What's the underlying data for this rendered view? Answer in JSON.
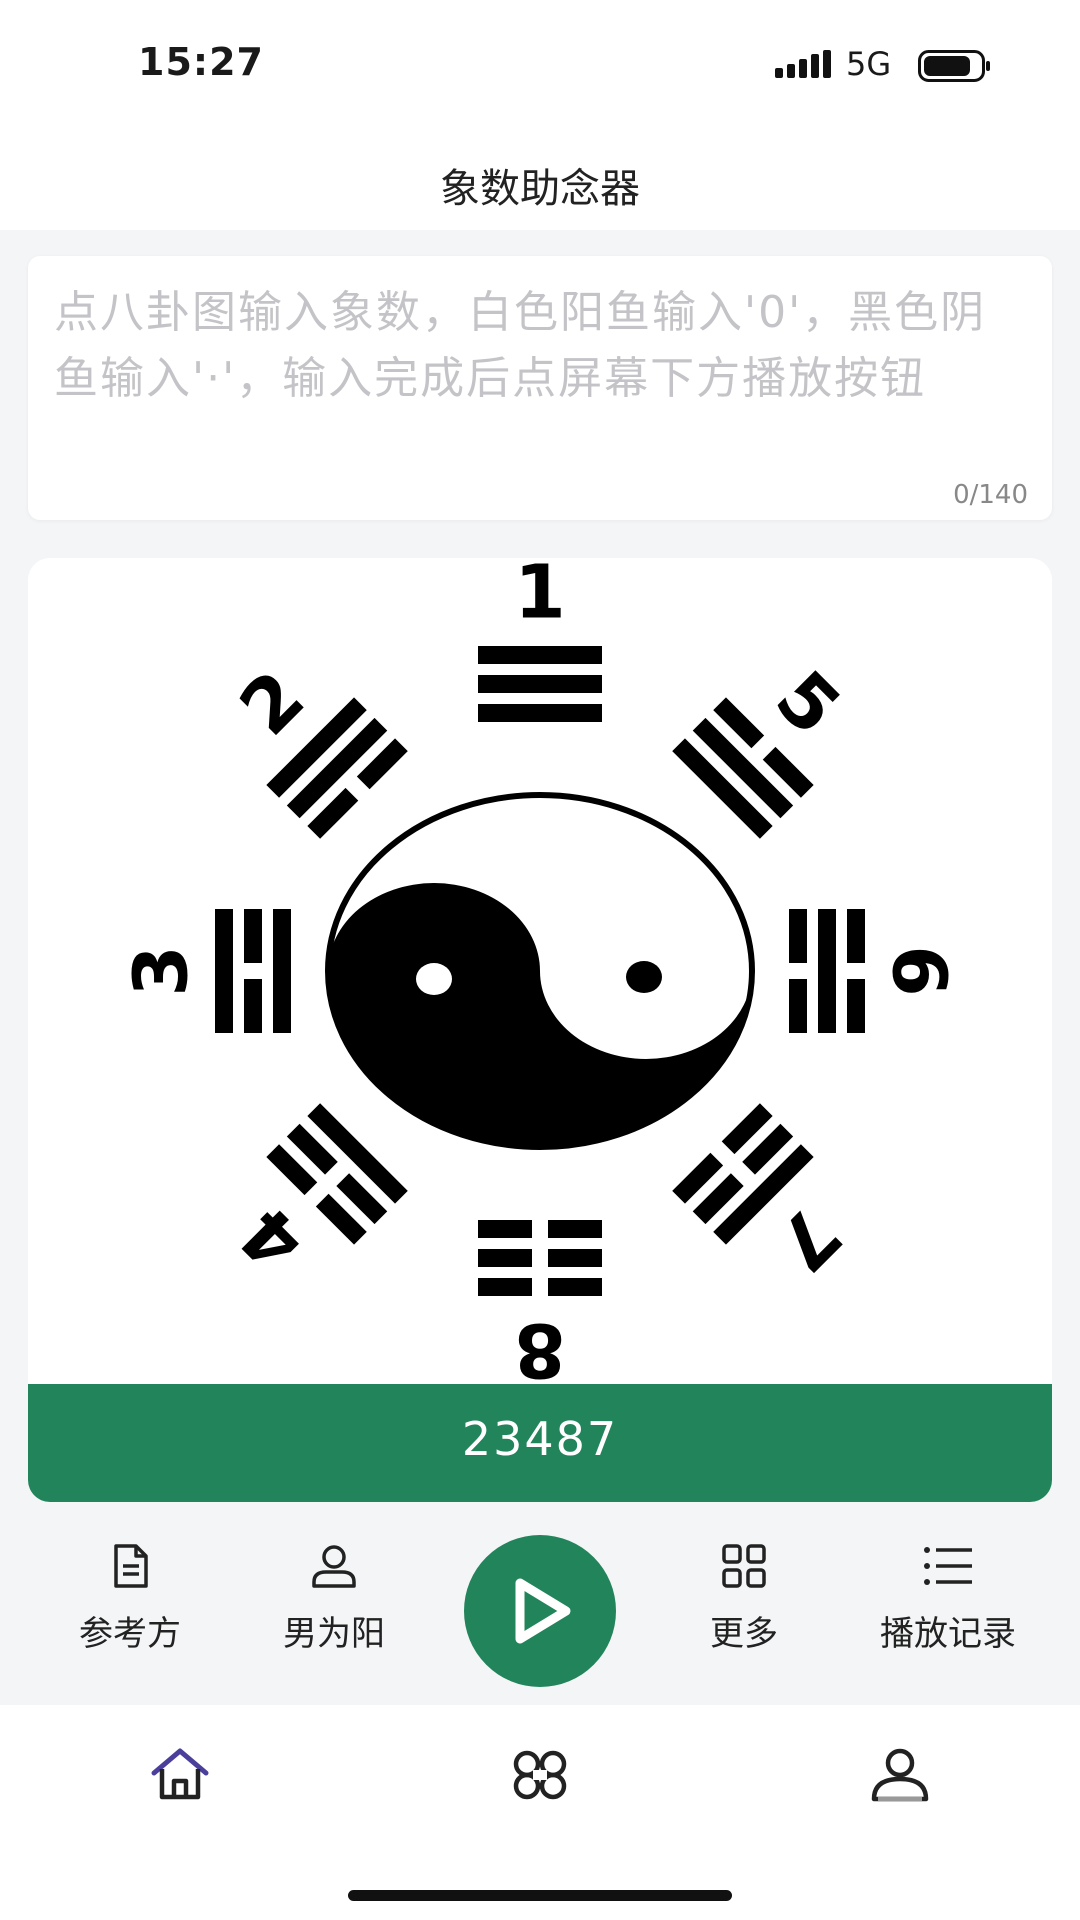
{
  "status": {
    "time": "15:27",
    "network": "5G"
  },
  "nav": {
    "title": "象数助念器"
  },
  "input": {
    "placeholder": "点八卦图输入象数，白色阳鱼输入'0'，黑色阴鱼输入'·'，输入完成后点屏幕下方播放按钮",
    "counter": "0/140"
  },
  "bagua": {
    "numbers": [
      "1",
      "2",
      "3",
      "4",
      "5",
      "6",
      "7",
      "8"
    ]
  },
  "result": {
    "value": "23487"
  },
  "toolbar": {
    "items": [
      {
        "label": "参考方",
        "icon": "document-icon"
      },
      {
        "label": "男为阳",
        "icon": "person-icon"
      },
      {
        "label": "",
        "icon": "play-icon"
      },
      {
        "label": "更多",
        "icon": "grid-icon"
      },
      {
        "label": "播放记录",
        "icon": "list-icon"
      }
    ]
  },
  "tabbar": {
    "items": [
      {
        "icon": "home-icon",
        "active": true
      },
      {
        "icon": "command-icon",
        "active": false
      },
      {
        "icon": "profile-icon",
        "active": false
      }
    ]
  },
  "colors": {
    "accent": "#22845a",
    "active_tab": "#4b3f9c"
  }
}
